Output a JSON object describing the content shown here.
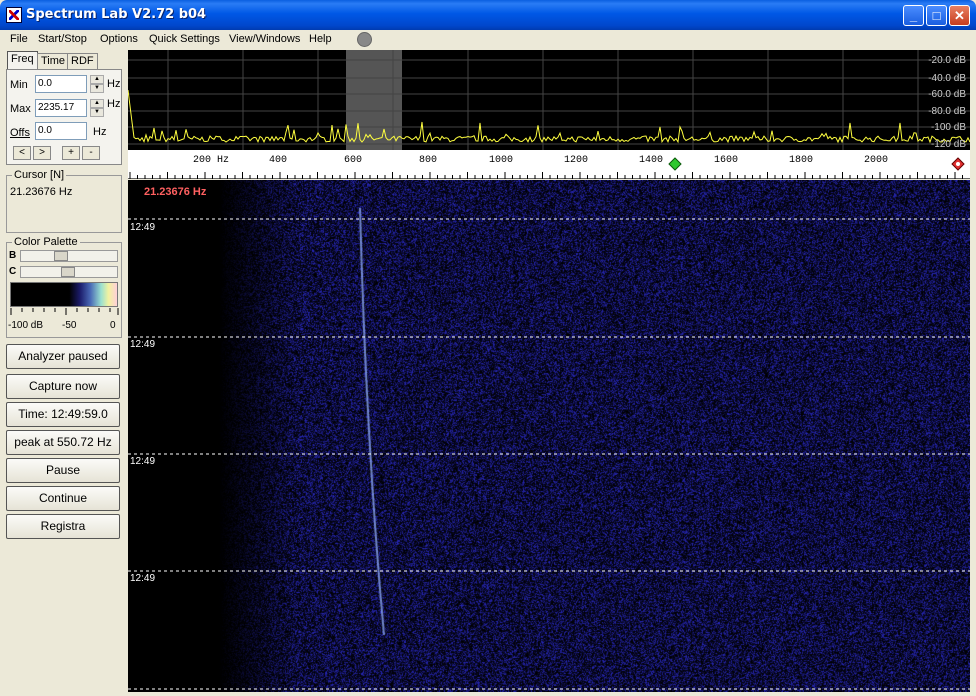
{
  "window": {
    "title": "Spectrum Lab V2.72 b04",
    "min": "_",
    "max": "□",
    "close": "✕"
  },
  "menu": [
    "File",
    "Start/Stop",
    "Options",
    "Quick Settings",
    "View/Windows",
    "Help"
  ],
  "tabs": [
    "Freq",
    "Time",
    "RDF"
  ],
  "freq": {
    "min_label": "Min",
    "min_value": "0.0",
    "min_unit": "Hz",
    "max_label": "Max",
    "max_value": "2235.17",
    "max_unit": "Hz",
    "offs_label": "Offs",
    "offs_value": "0.0",
    "offs_unit": "Hz",
    "buttons": [
      "<",
      ">",
      "+",
      "-"
    ]
  },
  "cursor": {
    "title": "Cursor [N]",
    "value": "21.23676 Hz"
  },
  "palette": {
    "title": "Color Palette",
    "b_label": "B",
    "c_label": "C",
    "scale": [
      "-100 dB",
      "-50",
      "0"
    ]
  },
  "buttons": [
    "Analyzer paused",
    "Capture now",
    "Time:  12:49:59.0",
    "peak at 550.72 Hz",
    "Pause",
    "Continue",
    "Registra"
  ],
  "spectrum": {
    "db_labels": [
      "-20.0 dB",
      "-40.0 dB",
      "-60.0 dB",
      "-80.0 dB",
      "-100 dB",
      "-120 dB"
    ],
    "freq_labels": [
      "200 Hz",
      "400",
      "600",
      "800",
      "1000",
      "1200",
      "1400",
      "1600",
      "1800",
      "2000"
    ]
  },
  "waterfall": {
    "cursor_readout": "21.23676 Hz",
    "times": [
      "12:49",
      "12:49",
      "12:49",
      "12:49"
    ]
  },
  "colors": {
    "trace": "#ffff40",
    "waterfall_noise": "#5a5ad0",
    "signal": "#8fb0ff",
    "cursor_text": "#ff6060"
  }
}
